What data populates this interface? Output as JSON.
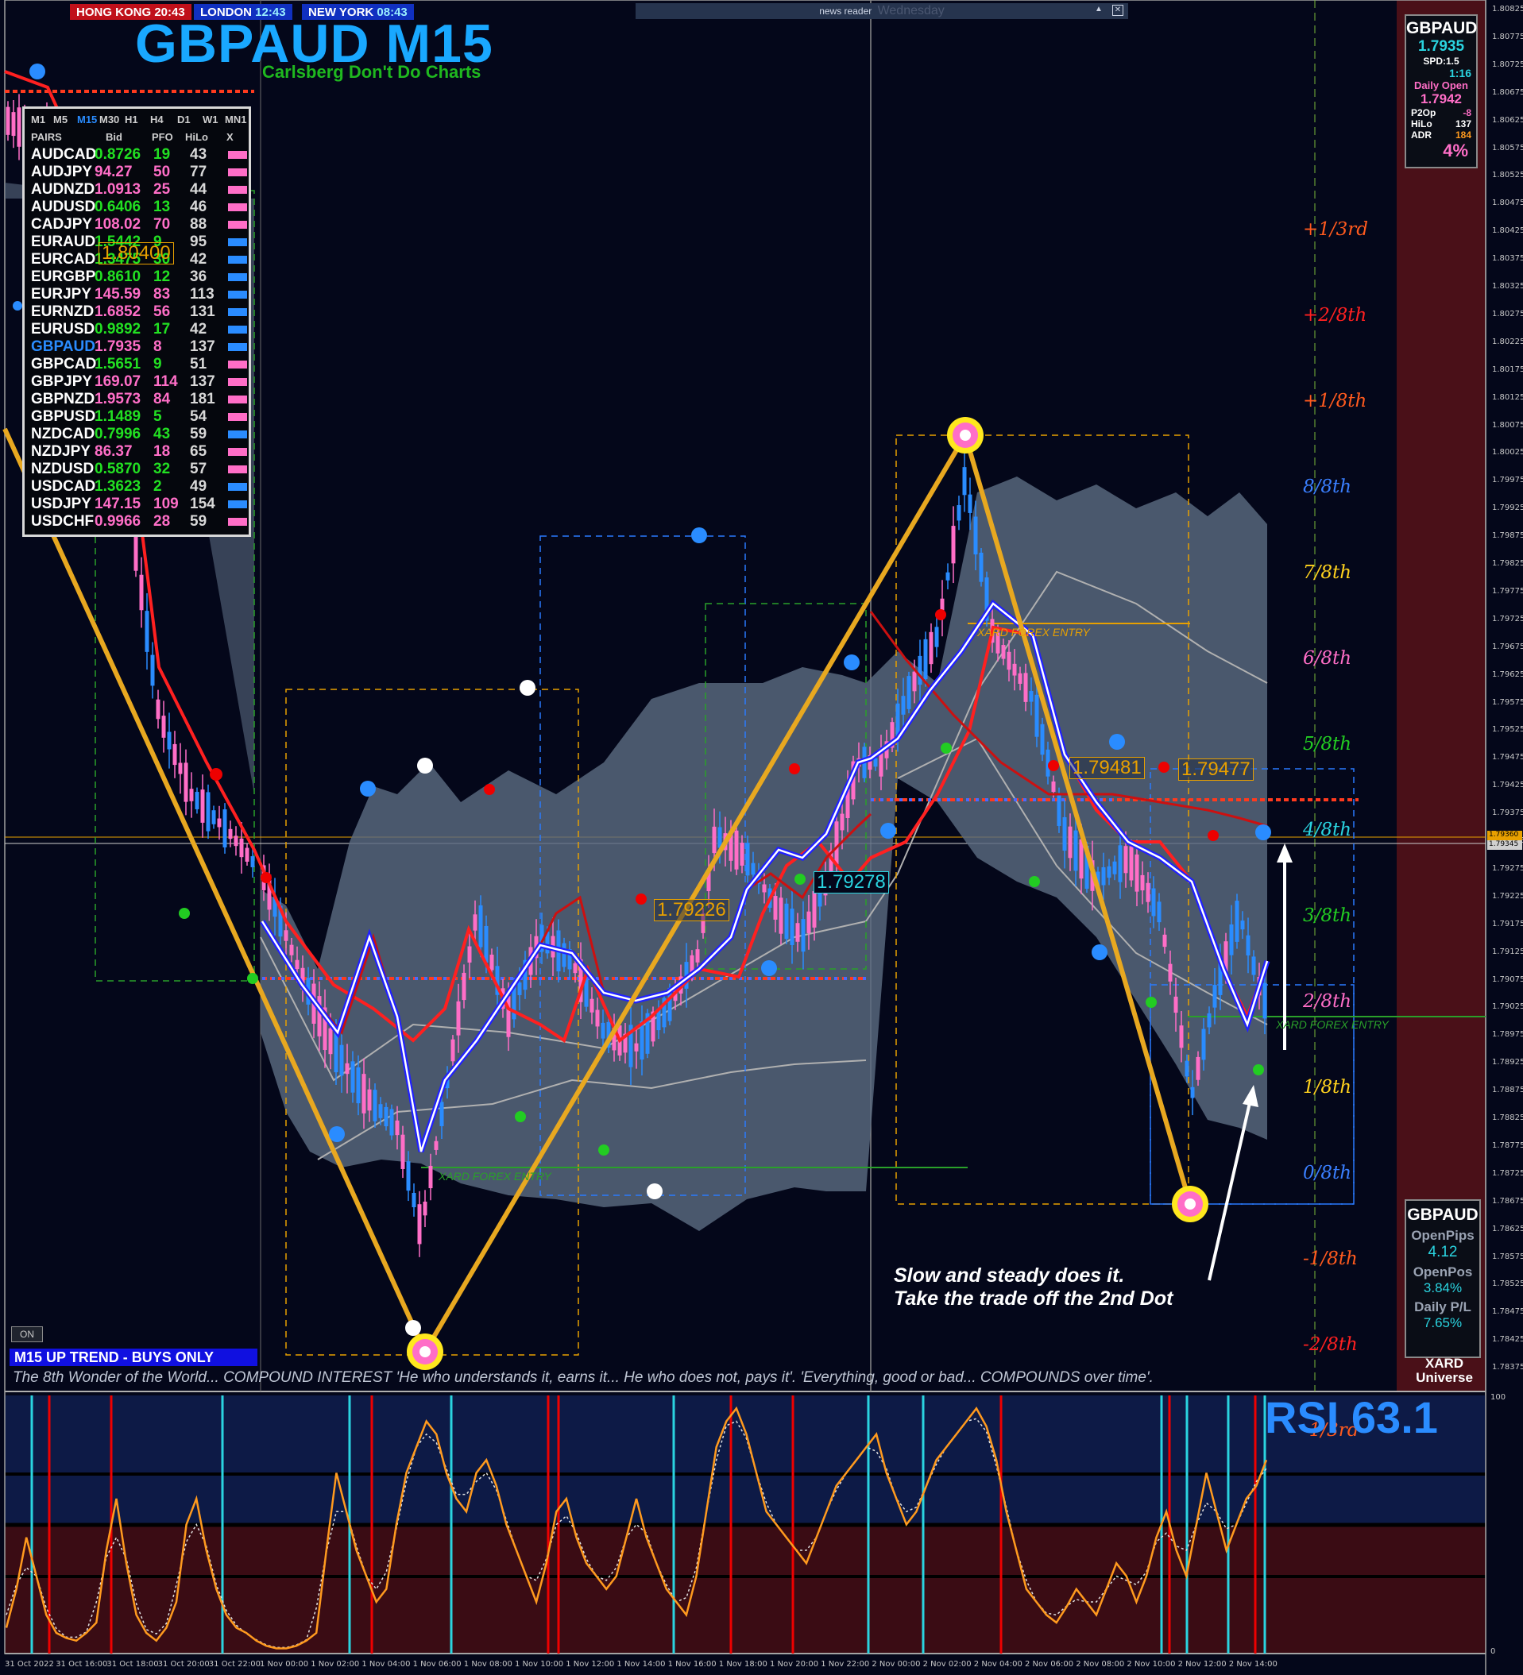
{
  "clocks": [
    {
      "city": "HONG KONG",
      "time": "20:43"
    },
    {
      "city": "LONDON",
      "time": "12:43"
    },
    {
      "city": "NEW YORK",
      "time": "08:43"
    }
  ],
  "chart_title": "GBPAUD M15",
  "subtitle": "Carlsberg Don't Do Charts",
  "news_reader": {
    "label": "news reader",
    "ghost": "Wednesday",
    "buttons": [
      "▲",
      "✕"
    ]
  },
  "pairs_table": {
    "timeframes": [
      "M1",
      "M5",
      "M15",
      "M30",
      "H1",
      "H4",
      "D1",
      "W1",
      "MN1"
    ],
    "headers": [
      "PAIRS",
      "Bid",
      "PFO",
      "HiLo",
      "X"
    ],
    "rows": [
      {
        "pair": "AUDCAD",
        "bid": "0.8726",
        "pfo": "19",
        "hilo": "43",
        "bid_color": "#22e022",
        "pfo_color": "#22e022",
        "x_color": "#ff6ec7"
      },
      {
        "pair": "AUDJPY",
        "bid": "94.27",
        "pfo": "50",
        "hilo": "77",
        "bid_color": "#ff6ec7",
        "pfo_color": "#ff6ec7",
        "x_color": "#ff6ec7"
      },
      {
        "pair": "AUDNZD",
        "bid": "1.0913",
        "pfo": "25",
        "hilo": "44",
        "bid_color": "#ff6ec7",
        "pfo_color": "#ff6ec7",
        "x_color": "#ff6ec7"
      },
      {
        "pair": "AUDUSD",
        "bid": "0.6406",
        "pfo": "13",
        "hilo": "46",
        "bid_color": "#22e022",
        "pfo_color": "#22e022",
        "x_color": "#ff6ec7"
      },
      {
        "pair": "CADJPY",
        "bid": "108.02",
        "pfo": "70",
        "hilo": "88",
        "bid_color": "#ff6ec7",
        "pfo_color": "#ff6ec7",
        "x_color": "#ff6ec7"
      },
      {
        "pair": "EURAUD",
        "bid": "1.5442",
        "pfo": "9",
        "hilo": "95",
        "bid_color": "#22e022",
        "pfo_color": "#22e022",
        "x_color": "#2a8cff"
      },
      {
        "pair": "EURCAD",
        "bid": "1.3475",
        "pfo": "30",
        "hilo": "42",
        "bid_color": "#22e022",
        "pfo_color": "#22e022",
        "x_color": "#2a8cff"
      },
      {
        "pair": "EURGBP",
        "bid": "0.8610",
        "pfo": "12",
        "hilo": "36",
        "bid_color": "#22e022",
        "pfo_color": "#22e022",
        "x_color": "#2a8cff"
      },
      {
        "pair": "EURJPY",
        "bid": "145.59",
        "pfo": "83",
        "hilo": "113",
        "bid_color": "#ff6ec7",
        "pfo_color": "#ff6ec7",
        "x_color": "#2a8cff"
      },
      {
        "pair": "EURNZD",
        "bid": "1.6852",
        "pfo": "56",
        "hilo": "131",
        "bid_color": "#ff6ec7",
        "pfo_color": "#ff6ec7",
        "x_color": "#2a8cff"
      },
      {
        "pair": "EURUSD",
        "bid": "0.9892",
        "pfo": "17",
        "hilo": "42",
        "bid_color": "#22e022",
        "pfo_color": "#22e022",
        "x_color": "#2a8cff"
      },
      {
        "pair": "GBPAUD",
        "bid": "1.7935",
        "pfo": "8",
        "hilo": "137",
        "bid_color": "#ff6ec7",
        "pfo_color": "#ff6ec7",
        "x_color": "#2a8cff"
      },
      {
        "pair": "GBPCAD",
        "bid": "1.5651",
        "pfo": "9",
        "hilo": "51",
        "bid_color": "#22e022",
        "pfo_color": "#22e022",
        "x_color": "#ff6ec7"
      },
      {
        "pair": "GBPJPY",
        "bid": "169.07",
        "pfo": "114",
        "hilo": "137",
        "bid_color": "#ff6ec7",
        "pfo_color": "#ff6ec7",
        "x_color": "#ff6ec7"
      },
      {
        "pair": "GBPNZD",
        "bid": "1.9573",
        "pfo": "84",
        "hilo": "181",
        "bid_color": "#ff6ec7",
        "pfo_color": "#ff6ec7",
        "x_color": "#ff6ec7"
      },
      {
        "pair": "GBPUSD",
        "bid": "1.1489",
        "pfo": "5",
        "hilo": "54",
        "bid_color": "#22e022",
        "pfo_color": "#22e022",
        "x_color": "#ff6ec7"
      },
      {
        "pair": "NZDCAD",
        "bid": "0.7996",
        "pfo": "43",
        "hilo": "59",
        "bid_color": "#22e022",
        "pfo_color": "#22e022",
        "x_color": "#2a8cff"
      },
      {
        "pair": "NZDJPY",
        "bid": "86.37",
        "pfo": "18",
        "hilo": "65",
        "bid_color": "#ff6ec7",
        "pfo_color": "#ff6ec7",
        "x_color": "#ff6ec7"
      },
      {
        "pair": "NZDUSD",
        "bid": "0.5870",
        "pfo": "32",
        "hilo": "57",
        "bid_color": "#22e022",
        "pfo_color": "#22e022",
        "x_color": "#ff6ec7"
      },
      {
        "pair": "USDCAD",
        "bid": "1.3623",
        "pfo": "2",
        "hilo": "49",
        "bid_color": "#22e022",
        "pfo_color": "#22e022",
        "x_color": "#2a8cff"
      },
      {
        "pair": "USDJPY",
        "bid": "147.15",
        "pfo": "109",
        "hilo": "154",
        "bid_color": "#ff6ec7",
        "pfo_color": "#ff6ec7",
        "x_color": "#2a8cff"
      },
      {
        "pair": "USDCHF",
        "bid": "0.9966",
        "pfo": "28",
        "hilo": "59",
        "bid_color": "#ff6ec7",
        "pfo_color": "#ff6ec7",
        "x_color": "#ff6ec7"
      }
    ],
    "overlay_price": "1.80400"
  },
  "info_box": {
    "symbol": "GBPAUD",
    "price": "1.7935",
    "spread": "SPD:1.5",
    "timer": "1:16",
    "daily_open_label": "Daily Open",
    "daily_open": "1.7942",
    "p2op_label": "P2Op",
    "p2op": "-8",
    "hilo_label": "HiLo",
    "hilo": "137",
    "adr_label": "ADR",
    "adr": "184",
    "adr_pct": "4%"
  },
  "account_box": {
    "symbol": "GBPAUD",
    "open_pips_label": "OpenPips",
    "open_pips": "4.12",
    "open_pos_label": "OpenPos",
    "open_pos": "3.84%",
    "daily_pl_label": "Daily P/L",
    "daily_pl": "7.65%",
    "brand_line1": "XARD",
    "brand_line2": "Universe"
  },
  "levels": [
    {
      "label": "+1/3rd",
      "color": "#ff5a1e"
    },
    {
      "label": "+2/8th",
      "color": "#ff2020"
    },
    {
      "label": "+1/8th",
      "color": "#ff5a1e"
    },
    {
      "label": "8/8th",
      "color": "#3a7fff"
    },
    {
      "label": "7/8th",
      "color": "#ffd21e"
    },
    {
      "label": "6/8th",
      "color": "#ff6ec7"
    },
    {
      "label": "5/8th",
      "color": "#22cc22"
    },
    {
      "label": "4/8th",
      "color": "#2ad4e0"
    },
    {
      "label": "3/8th",
      "color": "#22cc22"
    },
    {
      "label": "2/8th",
      "color": "#ff6ec7"
    },
    {
      "label": "1/8th",
      "color": "#ffd21e"
    },
    {
      "label": "0/8th",
      "color": "#3a7fff"
    },
    {
      "label": "-1/8th",
      "color": "#ff5a1e"
    },
    {
      "label": "-2/8th",
      "color": "#ff2020"
    },
    {
      "label": "-1/3rd",
      "color": "#ff5a1e"
    }
  ],
  "price_axis": [
    "1.80825",
    "1.80775",
    "1.80725",
    "1.80675",
    "1.80625",
    "1.80575",
    "1.80525",
    "1.80475",
    "1.80425",
    "1.80375",
    "1.80325",
    "1.80275",
    "1.80225",
    "1.80175",
    "1.80125",
    "1.80075",
    "1.80025",
    "1.79975",
    "1.79925",
    "1.79875",
    "1.79825",
    "1.79775",
    "1.79725",
    "1.79675",
    "1.79625",
    "1.79575",
    "1.79525",
    "1.79475",
    "1.79425",
    "1.79375",
    "1.79325",
    "1.79275",
    "1.79225",
    "1.79175",
    "1.79125",
    "1.79075",
    "1.79025",
    "1.78975",
    "1.78925",
    "1.78875",
    "1.78825",
    "1.78775",
    "1.78725",
    "1.78675",
    "1.78625",
    "1.78575",
    "1.78525",
    "1.78475",
    "1.78425",
    "1.78375"
  ],
  "price_markers": {
    "current": "1.79360",
    "bid": "1.79345"
  },
  "price_labels": {
    "left": "1.79226",
    "mid": "1.79278",
    "right1": "1.79481",
    "right2": "1.79477"
  },
  "xard_entry": "XARD FOREX ENTRY",
  "trend_banner": "M15 UP TREND - BUYS ONLY",
  "on_button": "ON",
  "quote": "The 8th Wonder of the World... COMPOUND INTEREST  'He who understands it, earns it... He who does not, pays it'.        'Everything, good or bad... COMPOUNDS over time'.",
  "note": [
    "Slow and steady does it.",
    "Take the trade off the 2nd Dot"
  ],
  "rsi_label": "RSI 63.1",
  "rsi_axis": {
    "top": "100",
    "bottom": "0"
  },
  "time_axis": [
    "31 Oct 2022",
    "31 Oct 16:00",
    "31 Oct 18:00",
    "31 Oct 20:00",
    "31 Oct 22:00",
    "1 Nov 00:00",
    "1 Nov 02:00",
    "1 Nov 04:00",
    "1 Nov 06:00",
    "1 Nov 08:00",
    "1 Nov 10:00",
    "1 Nov 12:00",
    "1 Nov 14:00",
    "1 Nov 16:00",
    "1 Nov 18:00",
    "1 Nov 20:00",
    "1 Nov 22:00",
    "2 Nov 00:00",
    "2 Nov 02:00",
    "2 Nov 04:00",
    "2 Nov 06:00",
    "2 Nov 08:00",
    "2 Nov 10:00",
    "2 Nov 12:00",
    "2 Nov 14:00"
  ],
  "colors": {
    "bull": "#2a8cff",
    "bear": "#ff6ec7",
    "zigzag": "#e8a820",
    "ma_fast": "#ff2020",
    "ma_blue": "#2020ff",
    "band": "#5a6a80",
    "rsi": "#ff9a1e"
  }
}
